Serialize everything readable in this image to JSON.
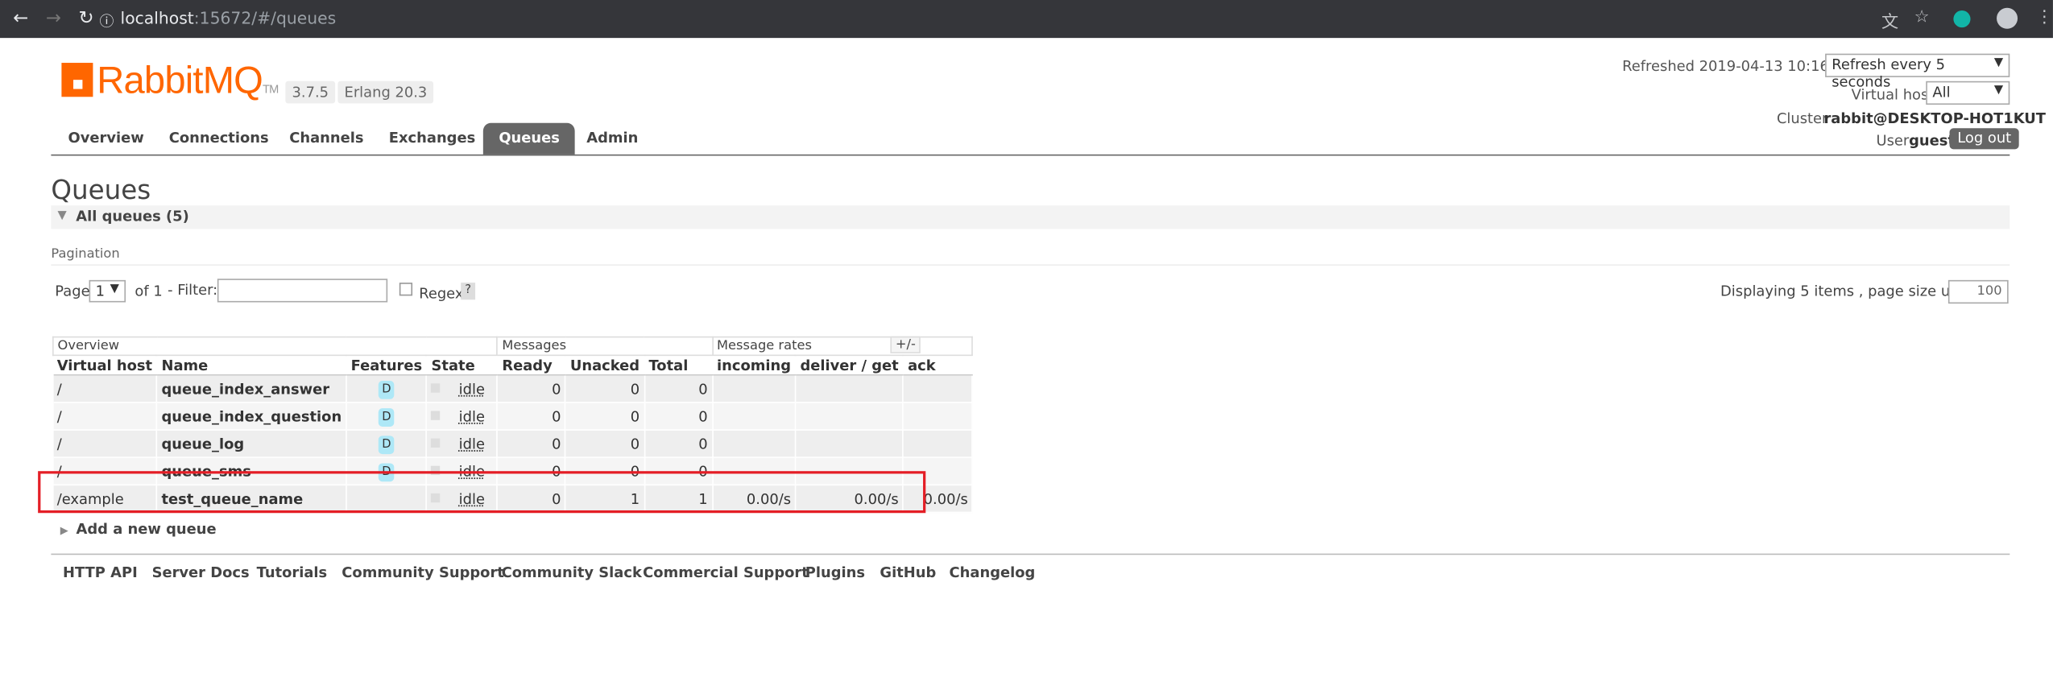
{
  "browser": {
    "url_host": "localhost",
    "url_rest": ":15672/#/queues"
  },
  "app": {
    "logo": "RabbitMQ",
    "logo_tm": "TM",
    "version": "3.7.5",
    "erlang": "Erlang 20.3"
  },
  "header": {
    "refreshed": "Refreshed 2019-04-13 10:16:01",
    "refresh_select": "Refresh every 5 seconds",
    "vhost_label": "Virtual host",
    "vhost_select": "All",
    "cluster_label": "Cluster",
    "cluster_value": "rabbit@DESKTOP-HOT1KUT",
    "user_label": "User",
    "user_value": "guest",
    "logout": "Log out"
  },
  "tabs": [
    "Overview",
    "Connections",
    "Channels",
    "Exchanges",
    "Queues",
    "Admin"
  ],
  "page": {
    "title": "Queues",
    "section": "All queues (5)",
    "pagination_title": "Pagination",
    "page_label": "Page",
    "page_value": "1",
    "of_label": "of 1",
    "filter_label": "- Filter:",
    "regex_label": "Regex",
    "regex_help": "?",
    "displaying": "Displaying 5 items , page size up to:",
    "page_size": "100"
  },
  "table": {
    "groups": [
      "Overview",
      "Messages",
      "Message rates"
    ],
    "plus_minus": "+/-",
    "columns": [
      "Virtual host",
      "Name",
      "Features",
      "State",
      "Ready",
      "Unacked",
      "Total",
      "incoming",
      "deliver / get",
      "ack"
    ],
    "rows": [
      {
        "vhost": "/",
        "name": "queue_index_answer",
        "feature": "D",
        "state": "idle",
        "ready": "0",
        "unacked": "0",
        "total": "0",
        "incoming": "",
        "deliver": "",
        "ack": ""
      },
      {
        "vhost": "/",
        "name": "queue_index_question",
        "feature": "D",
        "state": "idle",
        "ready": "0",
        "unacked": "0",
        "total": "0",
        "incoming": "",
        "deliver": "",
        "ack": ""
      },
      {
        "vhost": "/",
        "name": "queue_log",
        "feature": "D",
        "state": "idle",
        "ready": "0",
        "unacked": "0",
        "total": "0",
        "incoming": "",
        "deliver": "",
        "ack": ""
      },
      {
        "vhost": "/",
        "name": "queue_sms",
        "feature": "D",
        "state": "idle",
        "ready": "0",
        "unacked": "0",
        "total": "0",
        "incoming": "",
        "deliver": "",
        "ack": ""
      },
      {
        "vhost": "/example",
        "name": "test_queue_name",
        "feature": "",
        "state": "idle",
        "ready": "0",
        "unacked": "1",
        "total": "1",
        "incoming": "0.00/s",
        "deliver": "0.00/s",
        "ack": "0.00/s"
      }
    ]
  },
  "add_queue": "Add a new queue",
  "footer": [
    "HTTP API",
    "Server Docs",
    "Tutorials",
    "Community Support",
    "Community Slack",
    "Commercial Support",
    "Plugins",
    "GitHub",
    "Changelog"
  ],
  "colors": {
    "brand": "#ff6600",
    "highlight": "#e41e26",
    "tab_active": "#666666"
  }
}
